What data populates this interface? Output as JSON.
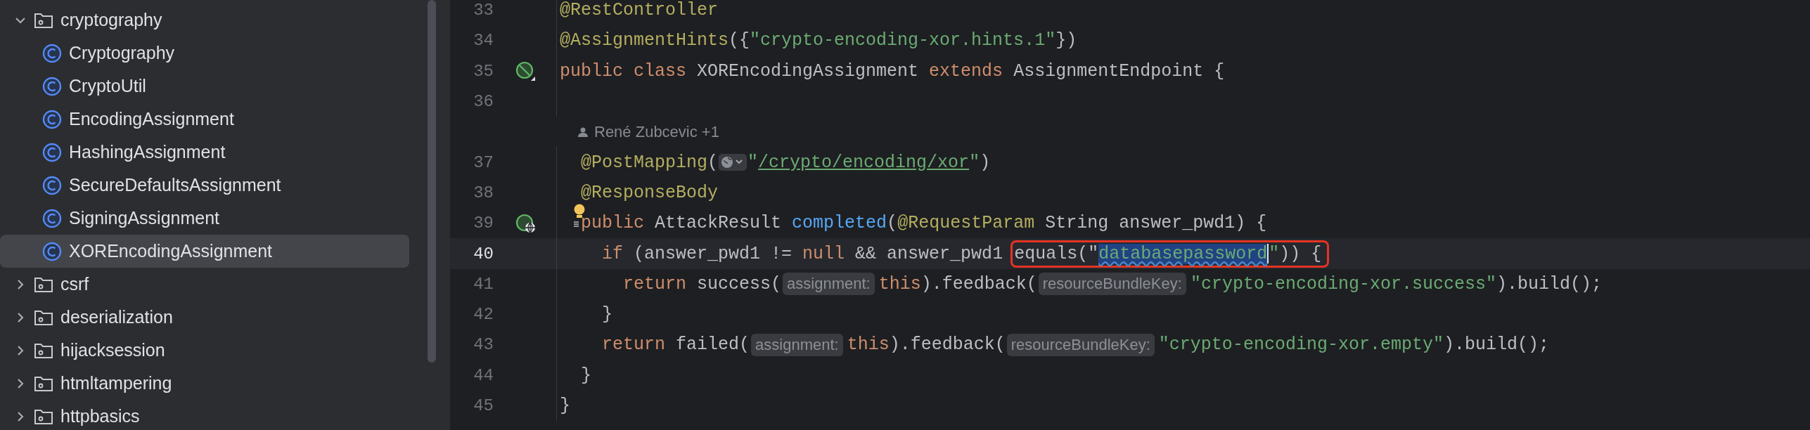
{
  "sidebar": {
    "items": [
      {
        "label": "cryptography",
        "kind": "folder",
        "expanded": true,
        "selected": false,
        "children": [
          {
            "label": "Cryptography",
            "kind": "class",
            "selected": false
          },
          {
            "label": "CryptoUtil",
            "kind": "class",
            "selected": false
          },
          {
            "label": "EncodingAssignment",
            "kind": "class",
            "selected": false
          },
          {
            "label": "HashingAssignment",
            "kind": "class",
            "selected": false
          },
          {
            "label": "SecureDefaultsAssignment",
            "kind": "class",
            "selected": false
          },
          {
            "label": "SigningAssignment",
            "kind": "class",
            "selected": false
          },
          {
            "label": "XOREncodingAssignment",
            "kind": "class",
            "selected": true
          }
        ]
      },
      {
        "label": "csrf",
        "kind": "folder",
        "expanded": false,
        "selected": false
      },
      {
        "label": "deserialization",
        "kind": "folder",
        "expanded": false,
        "selected": false
      },
      {
        "label": "hijacksession",
        "kind": "folder",
        "expanded": false,
        "selected": false
      },
      {
        "label": "htmltampering",
        "kind": "folder",
        "expanded": false,
        "selected": false
      },
      {
        "label": "httpbasics",
        "kind": "folder",
        "expanded": false,
        "selected": false
      }
    ]
  },
  "editor": {
    "lines": [
      {
        "kind": "code",
        "number": "33",
        "current": false,
        "tokens": [
          {
            "kind": "ann",
            "text": "@RestController"
          }
        ]
      },
      {
        "kind": "code",
        "number": "34",
        "current": false,
        "tokens": [
          {
            "kind": "ann",
            "text": "@AssignmentHints"
          },
          {
            "kind": "plain",
            "text": "({"
          },
          {
            "kind": "str",
            "text": "\"crypto-encoding-xor.hints.1\""
          },
          {
            "kind": "plain",
            "text": "})"
          }
        ]
      },
      {
        "kind": "code",
        "number": "35",
        "current": false,
        "gutter": {
          "kind": "blocked"
        },
        "tokens": [
          {
            "kind": "kw",
            "text": "public class "
          },
          {
            "kind": "plain",
            "text": "XOREncodingAssignment "
          },
          {
            "kind": "kw",
            "text": "extends "
          },
          {
            "kind": "plain",
            "text": "AssignmentEndpoint {"
          }
        ]
      },
      {
        "kind": "code",
        "number": "36",
        "current": false
      },
      {
        "kind": "author",
        "text": "René Zubcevic +1"
      },
      {
        "kind": "code",
        "number": "37",
        "current": false,
        "tokens": [
          {
            "kind": "ann",
            "text": "  @PostMapping"
          },
          {
            "kind": "plain",
            "text": "("
          },
          {
            "kind": "globe"
          },
          {
            "kind": "str",
            "text": "\""
          },
          {
            "kind": "link",
            "text": "/crypto/encoding/xor"
          },
          {
            "kind": "str",
            "text": "\""
          },
          {
            "kind": "plain",
            "text": ")"
          }
        ]
      },
      {
        "kind": "code",
        "number": "38",
        "current": false,
        "tokens": [
          {
            "kind": "ann",
            "text": "  @ResponseBody"
          }
        ]
      },
      {
        "kind": "code",
        "number": "39",
        "current": false,
        "gutter": {
          "kind": "web"
        },
        "tokens": [
          {
            "kind": "bulb"
          },
          {
            "kind": "kw",
            "text": "public "
          },
          {
            "kind": "plain",
            "text": "AttackResult "
          },
          {
            "kind": "fn",
            "text": "completed"
          },
          {
            "kind": "plain",
            "text": "("
          },
          {
            "kind": "ann",
            "text": "@RequestParam "
          },
          {
            "kind": "plain",
            "text": "String answer_pwd1) {"
          }
        ]
      },
      {
        "kind": "code",
        "number": "40",
        "current": true,
        "tokens": [
          {
            "kind": "kw",
            "text": "    if "
          },
          {
            "kind": "plain",
            "text": "(answer_pwd1 != "
          },
          {
            "kind": "kw",
            "text": "null "
          },
          {
            "kind": "plain",
            "text": "&& answer_pwd1 "
          },
          {
            "kind": "frame",
            "tokens": [
              {
                "kind": "plain",
                "text": "equals(\""
              },
              {
                "kind": "sel",
                "text": "databasepassword"
              },
              {
                "kind": "caret"
              },
              {
                "kind": "str",
                "text": "\""
              },
              {
                "kind": "plain",
                "text": ")) {"
              }
            ]
          }
        ]
      },
      {
        "kind": "code",
        "number": "41",
        "current": false,
        "tokens": [
          {
            "kind": "kw",
            "text": "      return "
          },
          {
            "kind": "plain",
            "text": "success("
          },
          {
            "kind": "hint",
            "text": "assignment:"
          },
          {
            "kind": "kw",
            "text": "this"
          },
          {
            "kind": "plain",
            "text": ").feedback("
          },
          {
            "kind": "hint",
            "text": "resourceBundleKey:"
          },
          {
            "kind": "str",
            "text": "\"crypto-encoding-xor.success\""
          },
          {
            "kind": "plain",
            "text": ").build();"
          }
        ]
      },
      {
        "kind": "code",
        "number": "42",
        "current": false,
        "tokens": [
          {
            "kind": "plain",
            "text": "    }"
          }
        ]
      },
      {
        "kind": "code",
        "number": "43",
        "current": false,
        "tokens": [
          {
            "kind": "kw",
            "text": "    return "
          },
          {
            "kind": "plain",
            "text": "failed("
          },
          {
            "kind": "hint",
            "text": "assignment:"
          },
          {
            "kind": "kw",
            "text": "this"
          },
          {
            "kind": "plain",
            "text": ").feedback("
          },
          {
            "kind": "hint",
            "text": "resourceBundleKey:"
          },
          {
            "kind": "str",
            "text": "\"crypto-encoding-xor.empty\""
          },
          {
            "kind": "plain",
            "text": ").build();"
          }
        ]
      },
      {
        "kind": "code",
        "number": "44",
        "current": false,
        "tokens": [
          {
            "kind": "plain",
            "text": "  }"
          }
        ]
      },
      {
        "kind": "code",
        "number": "45",
        "current": false,
        "tokens": [
          {
            "kind": "plain",
            "text": "}"
          }
        ]
      }
    ]
  }
}
